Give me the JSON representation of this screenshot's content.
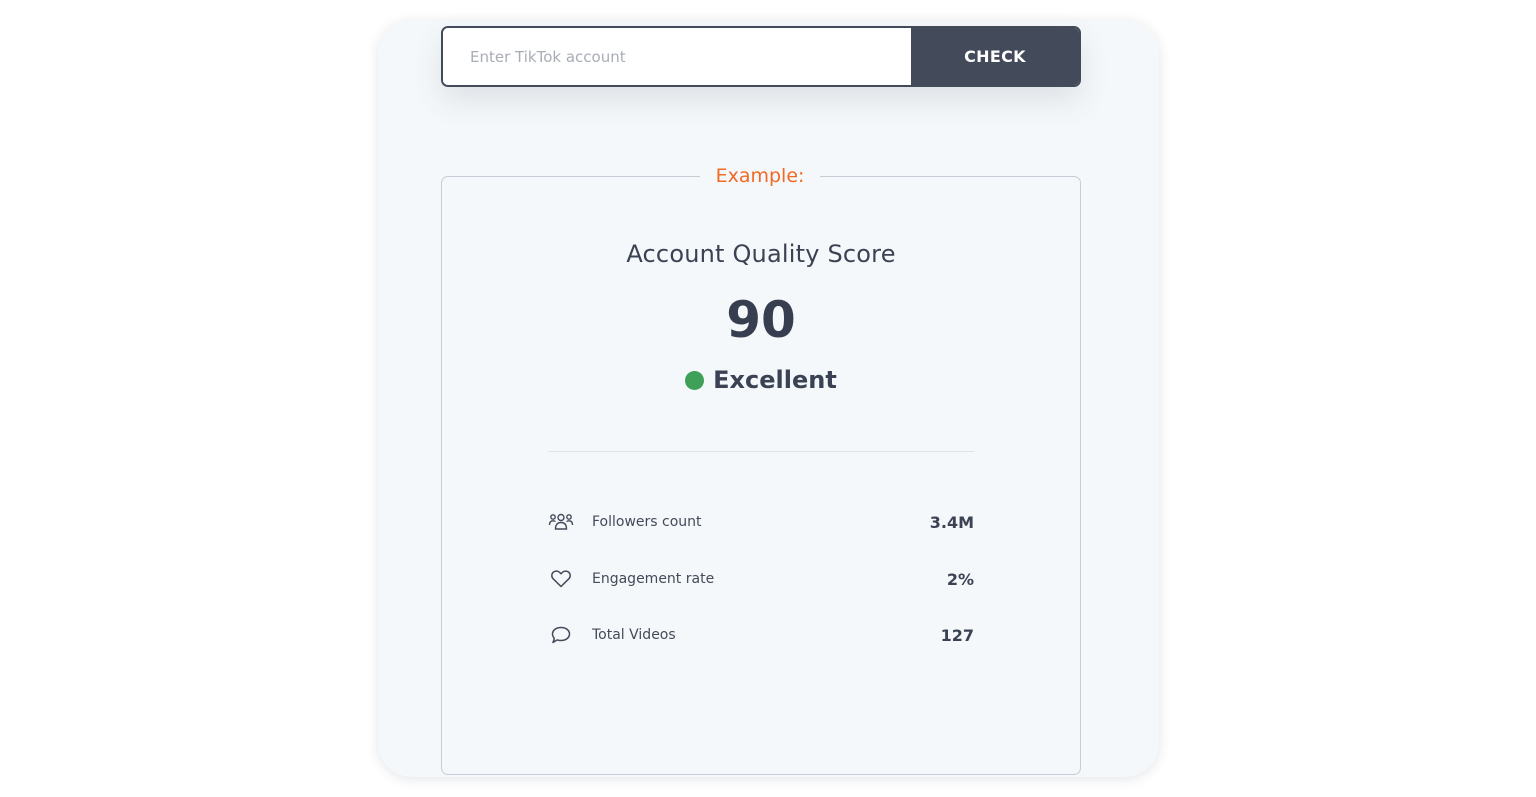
{
  "search": {
    "placeholder": "Enter TikTok account",
    "button_label": "CHECK"
  },
  "example": {
    "label": "Example:",
    "score_title": "Account Quality Score",
    "score_value": "90",
    "rating_label": "Excellent",
    "rating_color": "#3fa05a"
  },
  "stats": [
    {
      "icon": "followers-icon",
      "label": "Followers count",
      "value": "3.4M"
    },
    {
      "icon": "heart-icon",
      "label": "Engagement rate",
      "value": "2%"
    },
    {
      "icon": "comment-icon",
      "label": "Total Videos",
      "value": "127"
    }
  ],
  "colors": {
    "accent": "#ef6a24",
    "button": "#434a5a",
    "card_background": "#f5f8fa"
  }
}
